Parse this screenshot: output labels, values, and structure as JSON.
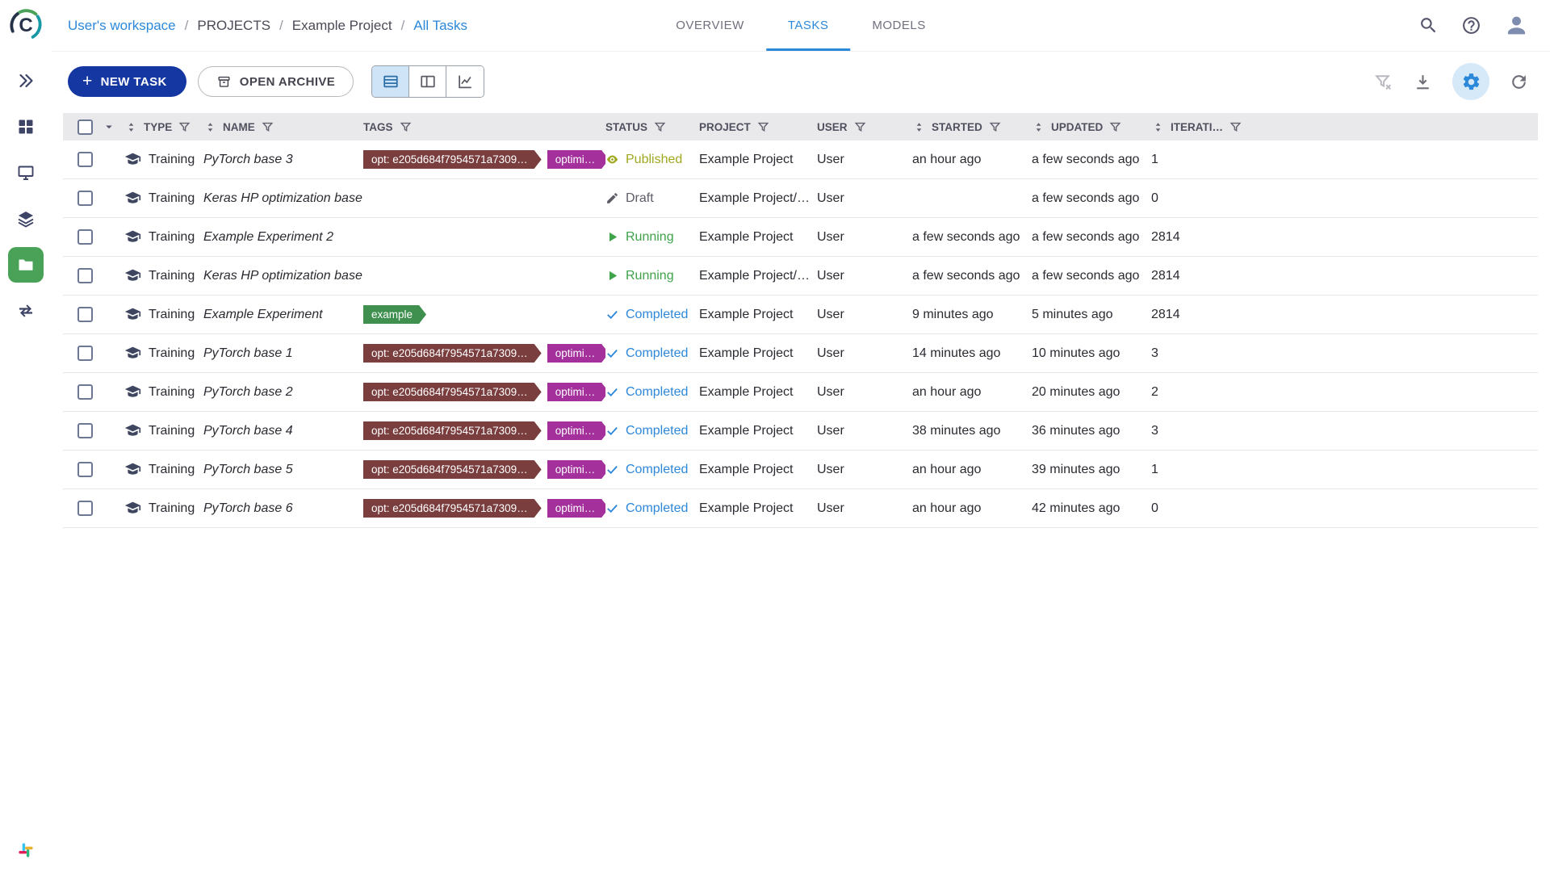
{
  "breadcrumb": {
    "separator": "/",
    "items": [
      {
        "label": "User's workspace",
        "link": true
      },
      {
        "label": "PROJECTS",
        "link": false
      },
      {
        "label": "Example Project",
        "link": false
      },
      {
        "label": "All Tasks",
        "link": true
      }
    ]
  },
  "tabs": [
    {
      "label": "OVERVIEW",
      "active": false
    },
    {
      "label": "TASKS",
      "active": true
    },
    {
      "label": "MODELS",
      "active": false
    }
  ],
  "header_actions": [
    {
      "name": "search"
    },
    {
      "name": "help"
    },
    {
      "name": "profile"
    }
  ],
  "sidebar": {
    "logo": "clearml-logo",
    "items": [
      {
        "name": "expand"
      },
      {
        "name": "dashboard"
      },
      {
        "name": "workers"
      },
      {
        "name": "datasets"
      },
      {
        "name": "projects",
        "active": true
      },
      {
        "name": "pipelines"
      }
    ],
    "bottom": [
      {
        "name": "slack"
      }
    ]
  },
  "toolbar": {
    "new_task_label": "NEW TASK",
    "open_archive_label": "OPEN ARCHIVE",
    "view_toggles": [
      {
        "name": "table-view",
        "active": true
      },
      {
        "name": "split-view",
        "active": false
      },
      {
        "name": "chart-view",
        "active": false
      }
    ],
    "right_actions": [
      {
        "name": "clear-filters",
        "disabled": true
      },
      {
        "name": "download"
      },
      {
        "name": "settings",
        "active": true
      },
      {
        "name": "auto-refresh"
      }
    ]
  },
  "table": {
    "columns": [
      {
        "key": "type",
        "label": "TYPE",
        "sortable": true,
        "filterable": true
      },
      {
        "key": "name",
        "label": "NAME",
        "sortable": true,
        "filterable": true
      },
      {
        "key": "tags",
        "label": "TAGS",
        "sortable": false,
        "filterable": true
      },
      {
        "key": "status",
        "label": "STATUS",
        "sortable": false,
        "filterable": true
      },
      {
        "key": "project",
        "label": "PROJECT",
        "sortable": false,
        "filterable": true
      },
      {
        "key": "user",
        "label": "USER",
        "sortable": false,
        "filterable": true
      },
      {
        "key": "started",
        "label": "STARTED",
        "sortable": true,
        "filterable": true
      },
      {
        "key": "updated",
        "label": "UPDATED",
        "sortable": true,
        "filterable": true
      },
      {
        "key": "iter",
        "label": "ITERATI…",
        "sortable": true,
        "filterable": true
      }
    ],
    "status_colors": {
      "published": "#a0a81f",
      "draft": "#5d5d68",
      "running": "#3ea34b",
      "completed": "#2c88d9"
    },
    "rows": [
      {
        "type": "Training",
        "name": "PyTorch base 3",
        "tags": [
          {
            "label": "opt: e205d684f7954571a7309…",
            "color": "#7a3e3e"
          },
          {
            "label": "optimi…",
            "color": "#a3309b"
          }
        ],
        "status": {
          "label": "Published",
          "kind": "published"
        },
        "project": "Example Project",
        "user": "User",
        "started": "an hour ago",
        "updated": "a few seconds ago",
        "iterations": "1"
      },
      {
        "type": "Training",
        "name": "Keras HP optimization base",
        "tags": [],
        "status": {
          "label": "Draft",
          "kind": "draft"
        },
        "project": "Example Project/Hy…",
        "user": "User",
        "started": "",
        "updated": "a few seconds ago",
        "iterations": "0"
      },
      {
        "type": "Training",
        "name": "Example Experiment 2",
        "tags": [],
        "status": {
          "label": "Running",
          "kind": "running"
        },
        "project": "Example Project",
        "user": "User",
        "started": "a few seconds ago",
        "updated": "a few seconds ago",
        "iterations": "2814"
      },
      {
        "type": "Training",
        "name": "Keras HP optimization base",
        "tags": [],
        "status": {
          "label": "Running",
          "kind": "running"
        },
        "project": "Example Project/Hy…",
        "user": "User",
        "started": "a few seconds ago",
        "updated": "a few seconds ago",
        "iterations": "2814"
      },
      {
        "type": "Training",
        "name": "Example Experiment",
        "tags": [
          {
            "label": "example",
            "color": "#3f8f4f"
          }
        ],
        "status": {
          "label": "Completed",
          "kind": "completed"
        },
        "project": "Example Project",
        "user": "User",
        "started": "9 minutes ago",
        "updated": "5 minutes ago",
        "iterations": "2814"
      },
      {
        "type": "Training",
        "name": "PyTorch base 1",
        "tags": [
          {
            "label": "opt: e205d684f7954571a7309…",
            "color": "#7a3e3e"
          },
          {
            "label": "optimi…",
            "color": "#a3309b"
          }
        ],
        "status": {
          "label": "Completed",
          "kind": "completed"
        },
        "project": "Example Project",
        "user": "User",
        "started": "14 minutes ago",
        "updated": "10 minutes ago",
        "iterations": "3"
      },
      {
        "type": "Training",
        "name": "PyTorch base 2",
        "tags": [
          {
            "label": "opt: e205d684f7954571a7309…",
            "color": "#7a3e3e"
          },
          {
            "label": "optimi…",
            "color": "#a3309b"
          }
        ],
        "status": {
          "label": "Completed",
          "kind": "completed"
        },
        "project": "Example Project",
        "user": "User",
        "started": "an hour ago",
        "updated": "20 minutes ago",
        "iterations": "2"
      },
      {
        "type": "Training",
        "name": "PyTorch base 4",
        "tags": [
          {
            "label": "opt: e205d684f7954571a7309…",
            "color": "#7a3e3e"
          },
          {
            "label": "optimi…",
            "color": "#a3309b"
          }
        ],
        "status": {
          "label": "Completed",
          "kind": "completed"
        },
        "project": "Example Project",
        "user": "User",
        "started": "38 minutes ago",
        "updated": "36 minutes ago",
        "iterations": "3"
      },
      {
        "type": "Training",
        "name": "PyTorch base 5",
        "tags": [
          {
            "label": "opt: e205d684f7954571a7309…",
            "color": "#7a3e3e"
          },
          {
            "label": "optimi…",
            "color": "#a3309b"
          }
        ],
        "status": {
          "label": "Completed",
          "kind": "completed"
        },
        "project": "Example Project",
        "user": "User",
        "started": "an hour ago",
        "updated": "39 minutes ago",
        "iterations": "1"
      },
      {
        "type": "Training",
        "name": "PyTorch base 6",
        "tags": [
          {
            "label": "opt: e205d684f7954571a7309…",
            "color": "#7a3e3e"
          },
          {
            "label": "optimi…",
            "color": "#a3309b"
          }
        ],
        "status": {
          "label": "Completed",
          "kind": "completed"
        },
        "project": "Example Project",
        "user": "User",
        "started": "an hour ago",
        "updated": "42 minutes ago",
        "iterations": "0"
      }
    ]
  }
}
